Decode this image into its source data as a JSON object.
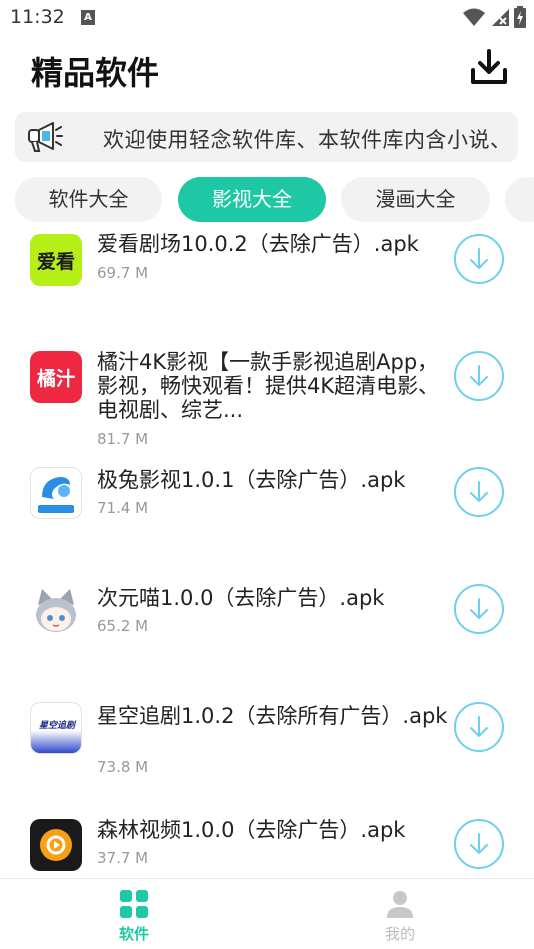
{
  "status_bar": {
    "time": "11:32",
    "badge": "A"
  },
  "header": {
    "title": "精品软件"
  },
  "notice": {
    "text": "欢迎使用轻念软件库、本软件库内含小说、"
  },
  "tabs": [
    {
      "label": "软件大全",
      "active": false
    },
    {
      "label": "影视大全",
      "active": true
    },
    {
      "label": "漫画大全",
      "active": false
    }
  ],
  "apps": [
    {
      "name": "爱看剧场10.0.2（去除广告）.apk",
      "size": "69.7 M",
      "icon_text": "爱看",
      "icon": "aikan-icon"
    },
    {
      "name": "橘汁4K影视【一款手影视追剧App，影视，畅快观看！提供4K超清电影、电视剧、综艺...",
      "size": "81.7 M",
      "icon_text": "橘汁",
      "icon": "juzhi-icon"
    },
    {
      "name": "极兔影视1.0.1（去除广告）.apk",
      "size": "71.4 M",
      "icon_text": "",
      "icon": "jitu-icon"
    },
    {
      "name": "次元喵1.0.0（去除广告）.apk",
      "size": "65.2 M",
      "icon_text": "",
      "icon": "ciyuanmiao-icon"
    },
    {
      "name": "星空追剧1.0.2（去除所有广告）.apk",
      "size": "73.8 M",
      "icon_text": "星空追剧",
      "icon": "xingkong-icon"
    },
    {
      "name": "森林视频1.0.0（去除广告）.apk",
      "size": "37.7 M",
      "icon_text": "",
      "icon": "senlin-icon"
    }
  ],
  "bottom_nav": [
    {
      "label": "软件",
      "active": true
    },
    {
      "label": "我的",
      "active": false
    }
  ],
  "colors": {
    "accent": "#1ec8a5",
    "download_ring": "#6ed0ee",
    "inactive": "#c8c8c8"
  }
}
